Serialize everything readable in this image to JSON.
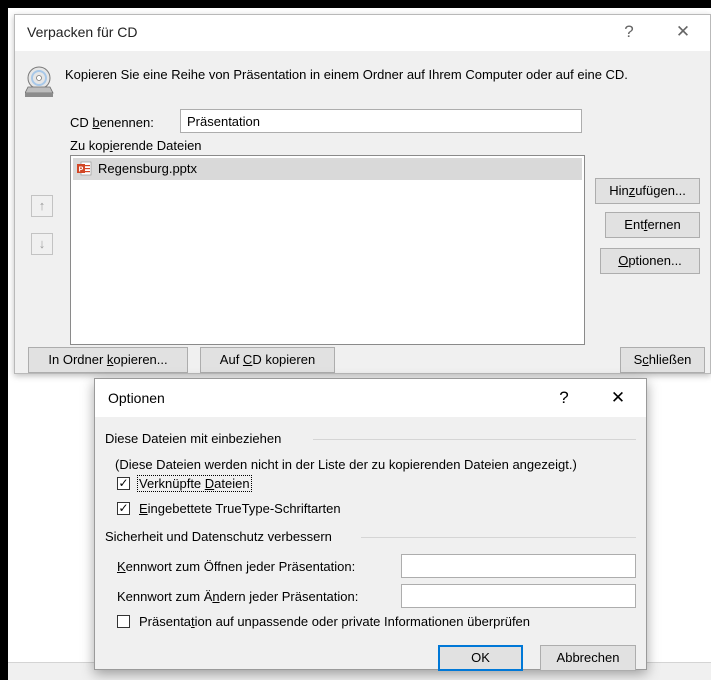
{
  "main_dialog": {
    "title": "Verpacken für CD",
    "help_glyph": "?",
    "close_glyph": "✕",
    "instruction": "Kopieren Sie eine Reihe von Präsentation in einem Ordner auf Ihrem Computer oder auf eine CD.",
    "cd_name_label": "CD benennen:",
    "cd_name_value": "Präsentation",
    "files_label": "Zu kopierende Dateien",
    "files": [
      "Regensburg.pptx"
    ],
    "move_up_glyph": "↑",
    "move_down_glyph": "↓",
    "buttons": {
      "add": "Hinzufügen...",
      "remove": "Entfernen",
      "options": "Optionen...",
      "copy_to_folder": "In Ordner kopieren...",
      "copy_to_cd": "Auf CD kopieren",
      "close": "Schließen"
    }
  },
  "options_dialog": {
    "title": "Optionen",
    "help_glyph": "?",
    "close_glyph": "✕",
    "include_section": "Diese Dateien mit einbeziehen",
    "include_note": "(Diese Dateien werden nicht in der Liste der zu kopierenden Dateien angezeigt.)",
    "checkbox_linked": {
      "label": "Verknüpfte Dateien",
      "checked": true
    },
    "checkbox_fonts": {
      "label": "Eingebettete TrueType-Schriftarten",
      "checked": true
    },
    "security_section": "Sicherheit und Datenschutz verbessern",
    "open_password_label": "Kennwort zum Öffnen jeder Präsentation:",
    "open_password_value": "",
    "modify_password_label": "Kennwort zum Ändern jeder Präsentation:",
    "modify_password_value": "",
    "checkbox_inspect": {
      "label": "Präsentation auf unpassende oder private Informationen überprüfen",
      "checked": false
    },
    "ok_button": "OK",
    "cancel_button": "Abbrechen",
    "check_glyph": "✓"
  },
  "colors": {
    "dialog_bg": "#f0f0f0",
    "button_bg": "#e1e1e1",
    "default_button_border": "#0078d7",
    "ppt_icon": "#d24726"
  },
  "icons": [
    "cd-drive-icon",
    "powerpoint-file-icon",
    "arrow-up-icon",
    "arrow-down-icon",
    "help-icon",
    "close-icon",
    "checkbox"
  ]
}
